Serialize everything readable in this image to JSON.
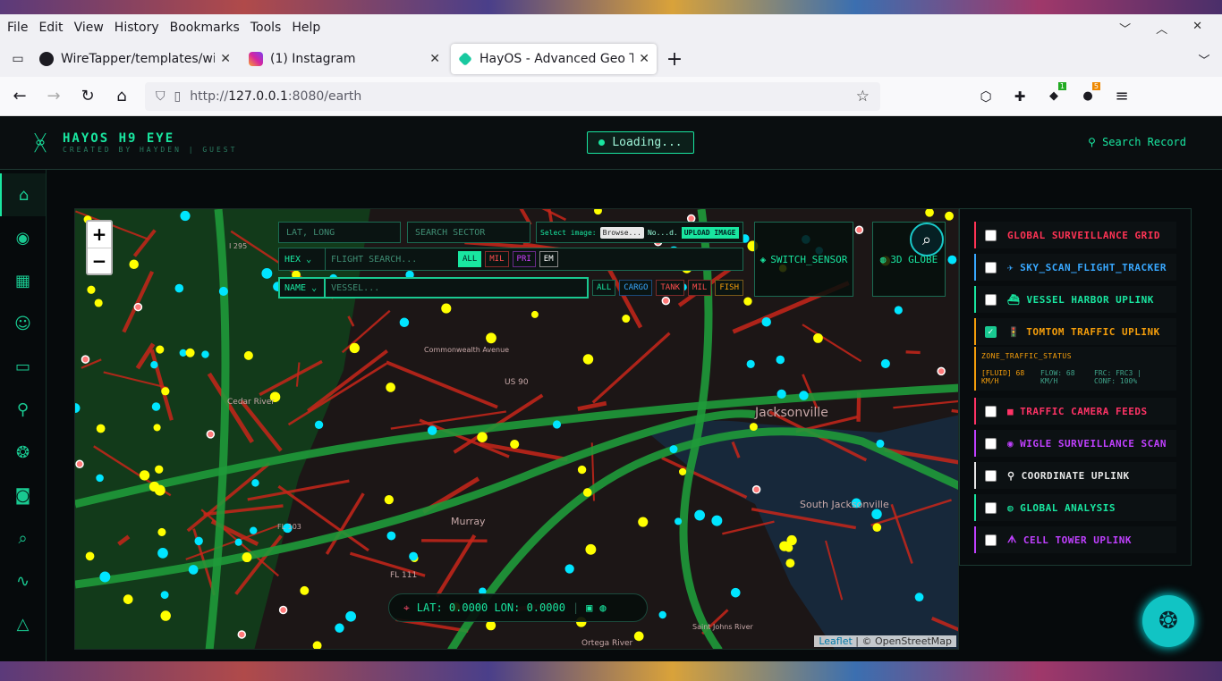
{
  "browser": {
    "menu": [
      "File",
      "Edit",
      "View",
      "History",
      "Bookmarks",
      "Tools",
      "Help"
    ],
    "tabs": [
      {
        "title": "WireTapper/templates/wifi",
        "icon": "github-icon",
        "color": "#1c1b22"
      },
      {
        "title": "(1) Instagram",
        "icon": "instagram-icon",
        "color": "#d6249f"
      },
      {
        "title": "HayOS - Advanced Geo Tra",
        "icon": "hayos-icon",
        "color": "#19c9a0"
      }
    ],
    "url_prefix": "http://",
    "url_host": "127.0.0.1",
    "url_path": ":8080/earth",
    "ext_badge_1": "1",
    "ext_badge_2": "5"
  },
  "app": {
    "title": "HAYOS H9 EYE",
    "subtitle": "CREATED BY HAYDEN | GUEST",
    "status": "Loading...",
    "search_record": "Search Record"
  },
  "map": {
    "latlong_placeholder": "LAT, LONG",
    "sector_placeholder": "SEARCH SECTOR",
    "select_image": "Select image:",
    "browse": "Browse...",
    "no_file": "No...d.",
    "upload": "UPLOAD IMAGE",
    "hex_select": "HEX",
    "flight_placeholder": "FLIGHT SEARCH...",
    "flight_filters": [
      "ALL",
      "MIL",
      "PRI",
      "EM"
    ],
    "name_select": "NAME",
    "vessel_placeholder": "VESSEL...",
    "vessel_filters": [
      "ALL",
      "CARGO",
      "TANK",
      "MIL",
      "FISH"
    ],
    "switch_sensor": "SWITCH_SENSOR",
    "globe_3d": "3D GLOBE",
    "zoom_in": "+",
    "zoom_out": "−",
    "coord_readout": "LAT: 0.0000 LON: 0.0000",
    "attribution_leaflet": "Leaflet",
    "attribution_osm": "| © OpenStreetMap",
    "labels": [
      "Jacksonville",
      "Murray",
      "South Jacksonville",
      "Cedar River",
      "Commonwealth Avenue",
      "Ortega River",
      "Saint Johns River",
      "FL 111",
      "FL 103",
      "US 90",
      "I 295"
    ]
  },
  "layers": [
    {
      "label": "GLOBAL SURVEILLANCE GRID",
      "color": "#ff3355",
      "icon": "",
      "checked": false
    },
    {
      "label": "SKY_SCAN_FLIGHT_TRACKER",
      "color": "#38a8ff",
      "icon": "✈",
      "checked": false
    },
    {
      "label": "VESSEL HARBOR UPLINK",
      "color": "#19e6a0",
      "icon": "⛴",
      "checked": false
    },
    {
      "label": "TOMTOM TRAFFIC UPLINK",
      "color": "#f59e0b",
      "icon": "🚦",
      "checked": true
    },
    {
      "label": "TRAFFIC CAMERA FEEDS",
      "color": "#ff3366",
      "icon": "■",
      "checked": false
    },
    {
      "label": "WIGLE SURVEILLANCE SCAN",
      "color": "#c040ff",
      "icon": "◉",
      "checked": false
    },
    {
      "label": "COORDINATE UPLINK",
      "color": "#e6e6e6",
      "icon": "⚲",
      "checked": false
    },
    {
      "label": "GLOBAL ANALYSIS",
      "color": "#19e6a0",
      "icon": "◍",
      "checked": false
    },
    {
      "label": "CELL TOWER UPLINK",
      "color": "#c040ff",
      "icon": "ᗑ",
      "checked": false
    }
  ],
  "zone": {
    "title": "ZONE_TRAFFIC_STATUS",
    "state": "[FLUID] 68 KM/H",
    "flow": "FLOW: 68 KM/H",
    "frc": "FRC: FRC3 | CONF: 100%"
  }
}
